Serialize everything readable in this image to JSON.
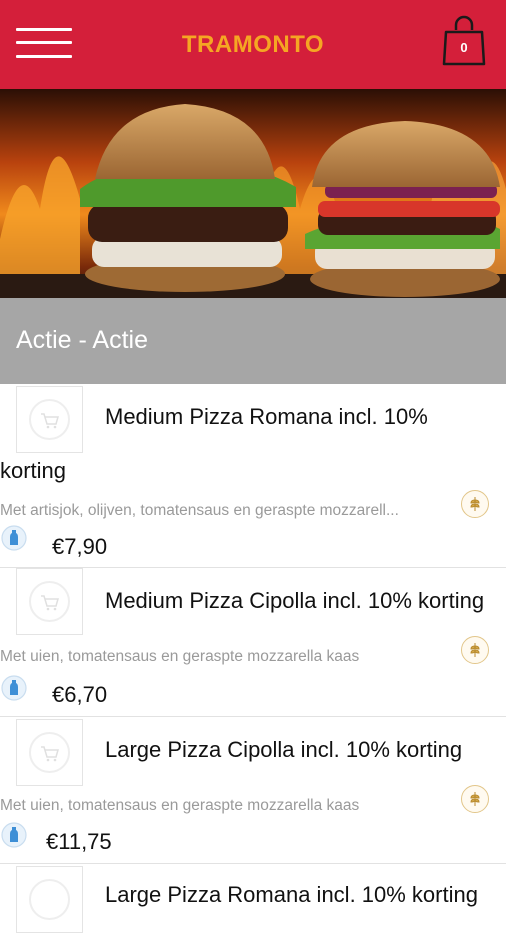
{
  "header": {
    "brand": "TRAMONTO",
    "cart_count": "0"
  },
  "section": {
    "title": "Actie - Actie"
  },
  "products": [
    {
      "name_line1": "Medium Pizza Romana incl. 10%",
      "name_line2": "korting",
      "description": "Met artisjok, olijven, tomatensaus en geraspte mozzarell...",
      "price": "€7,90"
    },
    {
      "name_line1": "Medium Pizza Cipolla incl. 10% korting",
      "description": "Met uien, tomatensaus en geraspte mozzarella kaas",
      "price": "€6,70"
    },
    {
      "name_line1": "Large Pizza Cipolla incl. 10% korting",
      "description": "Met uien, tomatensaus en geraspte mozzarella kaas",
      "price": "€11,75"
    },
    {
      "name_line1": "Large Pizza Romana incl. 10% korting"
    }
  ],
  "icons": {
    "menu": "hamburger-menu-icon",
    "cart": "shopping-bag-icon",
    "thumb": "shopping-cart-icon",
    "allergen": "wheat-icon",
    "vegetarian": "bottle-icon"
  },
  "colors": {
    "header_bg": "#d41f3a",
    "brand": "#f5a623",
    "section_bg": "#a6a6a6"
  }
}
